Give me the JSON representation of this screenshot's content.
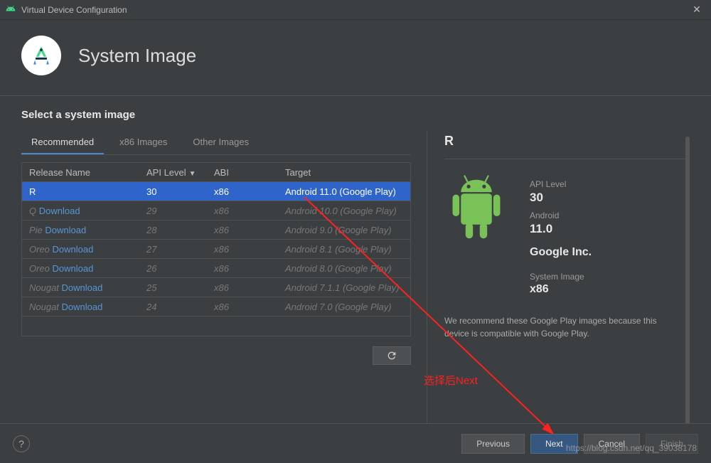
{
  "window": {
    "title": "Virtual Device Configuration"
  },
  "header": {
    "title": "System Image"
  },
  "section": {
    "title": "Select a system image"
  },
  "tabs": [
    {
      "label": "Recommended",
      "active": true
    },
    {
      "label": "x86 Images",
      "active": false
    },
    {
      "label": "Other Images",
      "active": false
    }
  ],
  "table": {
    "headers": {
      "release": "Release Name",
      "api": "API Level",
      "abi": "ABI",
      "target": "Target"
    },
    "rows": [
      {
        "release": "R",
        "download": null,
        "api": "30",
        "abi": "x86",
        "target": "Android 11.0 (Google Play)",
        "selected": true,
        "dimmed": false
      },
      {
        "release": "Q",
        "download": "Download",
        "api": "29",
        "abi": "x86",
        "target": "Android 10.0 (Google Play)",
        "selected": false,
        "dimmed": true
      },
      {
        "release": "Pie",
        "download": "Download",
        "api": "28",
        "abi": "x86",
        "target": "Android 9.0 (Google Play)",
        "selected": false,
        "dimmed": true
      },
      {
        "release": "Oreo",
        "download": "Download",
        "api": "27",
        "abi": "x86",
        "target": "Android 8.1 (Google Play)",
        "selected": false,
        "dimmed": true
      },
      {
        "release": "Oreo",
        "download": "Download",
        "api": "26",
        "abi": "x86",
        "target": "Android 8.0 (Google Play)",
        "selected": false,
        "dimmed": true
      },
      {
        "release": "Nougat",
        "download": "Download",
        "api": "25",
        "abi": "x86",
        "target": "Android 7.1.1 (Google Play)",
        "selected": false,
        "dimmed": true
      },
      {
        "release": "Nougat",
        "download": "Download",
        "api": "24",
        "abi": "x86",
        "target": "Android 7.0 (Google Play)",
        "selected": false,
        "dimmed": true
      }
    ]
  },
  "detail": {
    "title": "R",
    "api_label": "API Level",
    "api_value": "30",
    "android_label": "Android",
    "android_value": "11.0",
    "vendor": "Google Inc.",
    "sys_label": "System Image",
    "sys_value": "x86",
    "note": "We recommend these Google Play images because this device is compatible with Google Play."
  },
  "footer": {
    "previous": "Previous",
    "next": "Next",
    "cancel": "Cancel",
    "finish": "Finish"
  },
  "annotation": {
    "text": "选择后Next"
  },
  "watermark": "https://blog.csdn.net/qq_39038178"
}
